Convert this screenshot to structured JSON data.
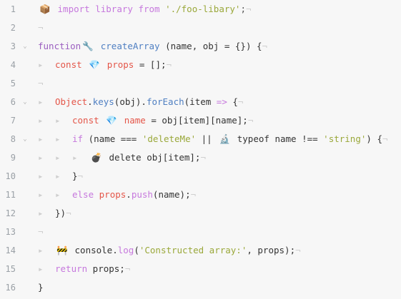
{
  "editor": {
    "lines": [
      {
        "num": "1",
        "fold": "",
        "indent": "",
        "tokens": [
          {
            "t": "emoji",
            "v": "📦"
          },
          {
            "t": "plain",
            "v": " "
          },
          {
            "t": "kw",
            "v": "import"
          },
          {
            "t": "plain",
            "v": " "
          },
          {
            "t": "kw",
            "v": "library"
          },
          {
            "t": "plain",
            "v": " "
          },
          {
            "t": "kw",
            "v": "from"
          },
          {
            "t": "plain",
            "v": " "
          },
          {
            "t": "str",
            "v": "'./foo-libary'"
          },
          {
            "t": "punct",
            "v": ";"
          },
          {
            "t": "ws",
            "v": "¬"
          }
        ]
      },
      {
        "num": "2",
        "fold": "",
        "indent": "",
        "tokens": [
          {
            "t": "ws",
            "v": "¬"
          }
        ]
      },
      {
        "num": "3",
        "fold": "⌄",
        "indent": "",
        "tokens": [
          {
            "t": "kw2",
            "v": "function"
          },
          {
            "t": "emoji",
            "v": "🔧"
          },
          {
            "t": "plain",
            "v": " "
          },
          {
            "t": "fn",
            "v": "createArray"
          },
          {
            "t": "plain",
            "v": " (name, obj = {}) {"
          },
          {
            "t": "ws",
            "v": "¬"
          }
        ]
      },
      {
        "num": "4",
        "fold": "",
        "indent": "ws1",
        "tokens": [
          {
            "t": "var",
            "v": "const"
          },
          {
            "t": "plain",
            "v": " "
          },
          {
            "t": "emoji",
            "v": "💎"
          },
          {
            "t": "plain",
            "v": " "
          },
          {
            "t": "var",
            "v": "props"
          },
          {
            "t": "plain",
            "v": " = [];"
          },
          {
            "t": "ws",
            "v": "¬"
          }
        ]
      },
      {
        "num": "5",
        "fold": "",
        "indent": "",
        "tokens": [
          {
            "t": "ws",
            "v": "¬"
          }
        ]
      },
      {
        "num": "6",
        "fold": "⌄",
        "indent": "ws1",
        "tokens": [
          {
            "t": "obj",
            "v": "Object"
          },
          {
            "t": "plain",
            "v": "."
          },
          {
            "t": "prop",
            "v": "keys"
          },
          {
            "t": "plain",
            "v": "(obj)."
          },
          {
            "t": "prop",
            "v": "forEach"
          },
          {
            "t": "plain",
            "v": "(item "
          },
          {
            "t": "arrow",
            "v": "=>"
          },
          {
            "t": "plain",
            "v": " {"
          },
          {
            "t": "ws",
            "v": "¬"
          }
        ]
      },
      {
        "num": "7",
        "fold": "",
        "indent": "ws2",
        "tokens": [
          {
            "t": "var",
            "v": "const"
          },
          {
            "t": "plain",
            "v": " "
          },
          {
            "t": "emoji",
            "v": "💎"
          },
          {
            "t": "plain",
            "v": " "
          },
          {
            "t": "var",
            "v": "name"
          },
          {
            "t": "plain",
            "v": " = obj[item][name];"
          },
          {
            "t": "ws",
            "v": "¬"
          }
        ]
      },
      {
        "num": "8",
        "fold": "⌄",
        "indent": "ws2",
        "tokens": [
          {
            "t": "kw",
            "v": "if"
          },
          {
            "t": "plain",
            "v": " (name === "
          },
          {
            "t": "str",
            "v": "'deleteMe'"
          },
          {
            "t": "plain",
            "v": " || "
          },
          {
            "t": "emoji",
            "v": "🔬"
          },
          {
            "t": "plain",
            "v": " typeof name !== "
          },
          {
            "t": "str",
            "v": "'string'"
          },
          {
            "t": "plain",
            "v": ") {"
          },
          {
            "t": "ws",
            "v": "¬"
          }
        ]
      },
      {
        "num": "9",
        "fold": "",
        "indent": "ws3",
        "tokens": [
          {
            "t": "emoji",
            "v": "💣"
          },
          {
            "t": "plain",
            "v": " delete obj[item];"
          },
          {
            "t": "ws",
            "v": "¬"
          }
        ]
      },
      {
        "num": "10",
        "fold": "",
        "indent": "ws2",
        "tokens": [
          {
            "t": "plain",
            "v": "}"
          },
          {
            "t": "ws",
            "v": "¬"
          }
        ]
      },
      {
        "num": "11",
        "fold": "",
        "indent": "ws2",
        "tokens": [
          {
            "t": "kw",
            "v": "else"
          },
          {
            "t": "plain",
            "v": " "
          },
          {
            "t": "var",
            "v": "props"
          },
          {
            "t": "plain",
            "v": "."
          },
          {
            "t": "meth",
            "v": "push"
          },
          {
            "t": "plain",
            "v": "(name);"
          },
          {
            "t": "ws",
            "v": "¬"
          }
        ]
      },
      {
        "num": "12",
        "fold": "",
        "indent": "ws1",
        "tokens": [
          {
            "t": "plain",
            "v": "})"
          },
          {
            "t": "ws",
            "v": "¬"
          }
        ]
      },
      {
        "num": "13",
        "fold": "",
        "indent": "",
        "tokens": [
          {
            "t": "ws",
            "v": "¬"
          }
        ]
      },
      {
        "num": "14",
        "fold": "",
        "indent": "ws1",
        "tokens": [
          {
            "t": "emoji",
            "v": "🚧"
          },
          {
            "t": "plain",
            "v": " console."
          },
          {
            "t": "meth",
            "v": "log"
          },
          {
            "t": "plain",
            "v": "("
          },
          {
            "t": "str",
            "v": "'Constructed array:'"
          },
          {
            "t": "plain",
            "v": ", props);"
          },
          {
            "t": "ws",
            "v": "¬"
          }
        ]
      },
      {
        "num": "15",
        "fold": "",
        "indent": "ws1",
        "tokens": [
          {
            "t": "kw",
            "v": "return"
          },
          {
            "t": "plain",
            "v": " props;"
          },
          {
            "t": "ws",
            "v": "¬"
          }
        ]
      },
      {
        "num": "16",
        "fold": "",
        "indent": "",
        "tokens": [
          {
            "t": "plain",
            "v": "}"
          }
        ]
      }
    ],
    "indent_marker": "▸",
    "eol_marker": "¬"
  },
  "colors": {
    "background": "#f7f7f7",
    "keyword": "#c678dd",
    "function_name": "#4f7fc2",
    "string": "#9aa83a",
    "variable": "#e45649",
    "line_number": "#9aa0a6",
    "invisible": "#cfcfcf"
  }
}
